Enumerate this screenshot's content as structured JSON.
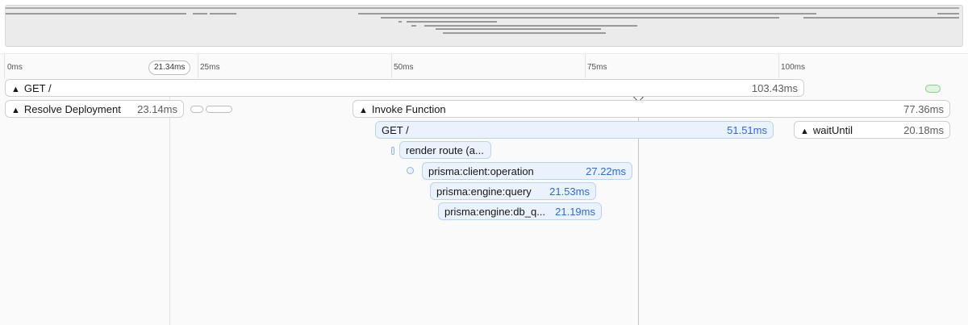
{
  "axis": {
    "ticks": [
      "0ms",
      "25ms",
      "50ms",
      "75ms",
      "100ms"
    ],
    "cursor_label": "21.34ms"
  },
  "spans": {
    "get_root": {
      "name": "GET /",
      "duration": "103.43ms"
    },
    "resolve_deployment": {
      "name": "Resolve Deployment",
      "duration": "23.14ms"
    },
    "invoke_function": {
      "name": "Invoke Function",
      "duration": "77.36ms"
    },
    "get_inner": {
      "name": "GET /",
      "duration": "51.51ms"
    },
    "wait_until": {
      "name": "waitUntil",
      "duration": "20.18ms"
    },
    "render_route": {
      "name": "render route (a..."
    },
    "prisma_client_operation": {
      "name": "prisma:client:operation",
      "duration": "27.22ms"
    },
    "prisma_engine_query": {
      "name": "prisma:engine:query",
      "duration": "21.53ms"
    },
    "prisma_engine_db_query": {
      "name": "prisma:engine:db_q...",
      "duration": "21.19ms"
    }
  }
}
